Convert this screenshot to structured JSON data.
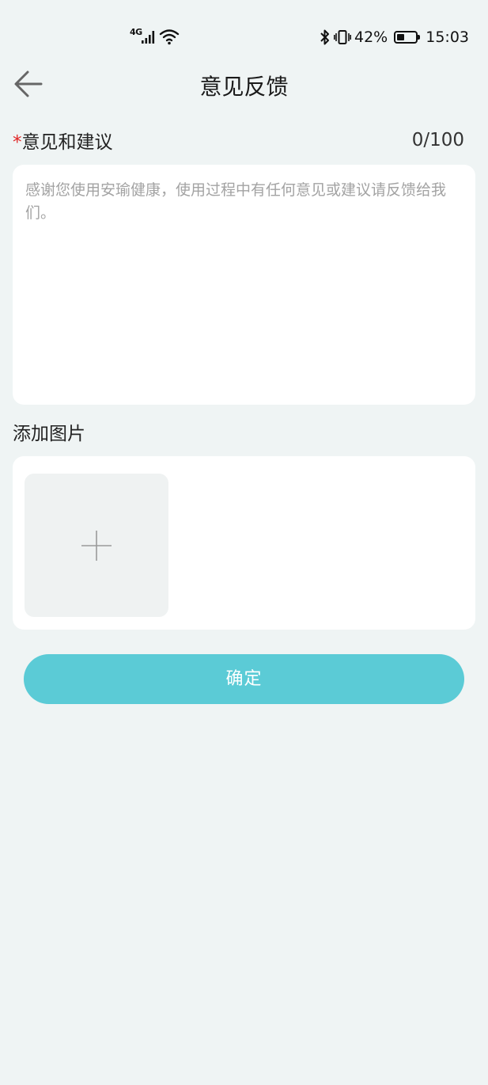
{
  "status_bar": {
    "network": "4G",
    "battery_percent": "42%",
    "battery_level": 0.42,
    "time": "15:03",
    "icons": [
      "signal-icon",
      "wifi-icon",
      "bluetooth-icon",
      "vibrate-icon",
      "battery-icon"
    ]
  },
  "nav": {
    "title": "意见反馈",
    "back_icon": "arrow-left-icon"
  },
  "feedback": {
    "required_mark": "*",
    "label": "意见和建议",
    "counter": "0/100",
    "value": "",
    "placeholder": "感谢您使用安瑜健康，使用过程中有任何意见或建议请反馈给我们。"
  },
  "images": {
    "label": "添加图片",
    "add_icon": "plus-icon"
  },
  "actions": {
    "confirm_label": "确定"
  },
  "colors": {
    "page_background": "#eff4f4",
    "primary_button": "#5bcbd6",
    "required_mark": "#e02525",
    "placeholder_text": "#a3a3a3"
  }
}
